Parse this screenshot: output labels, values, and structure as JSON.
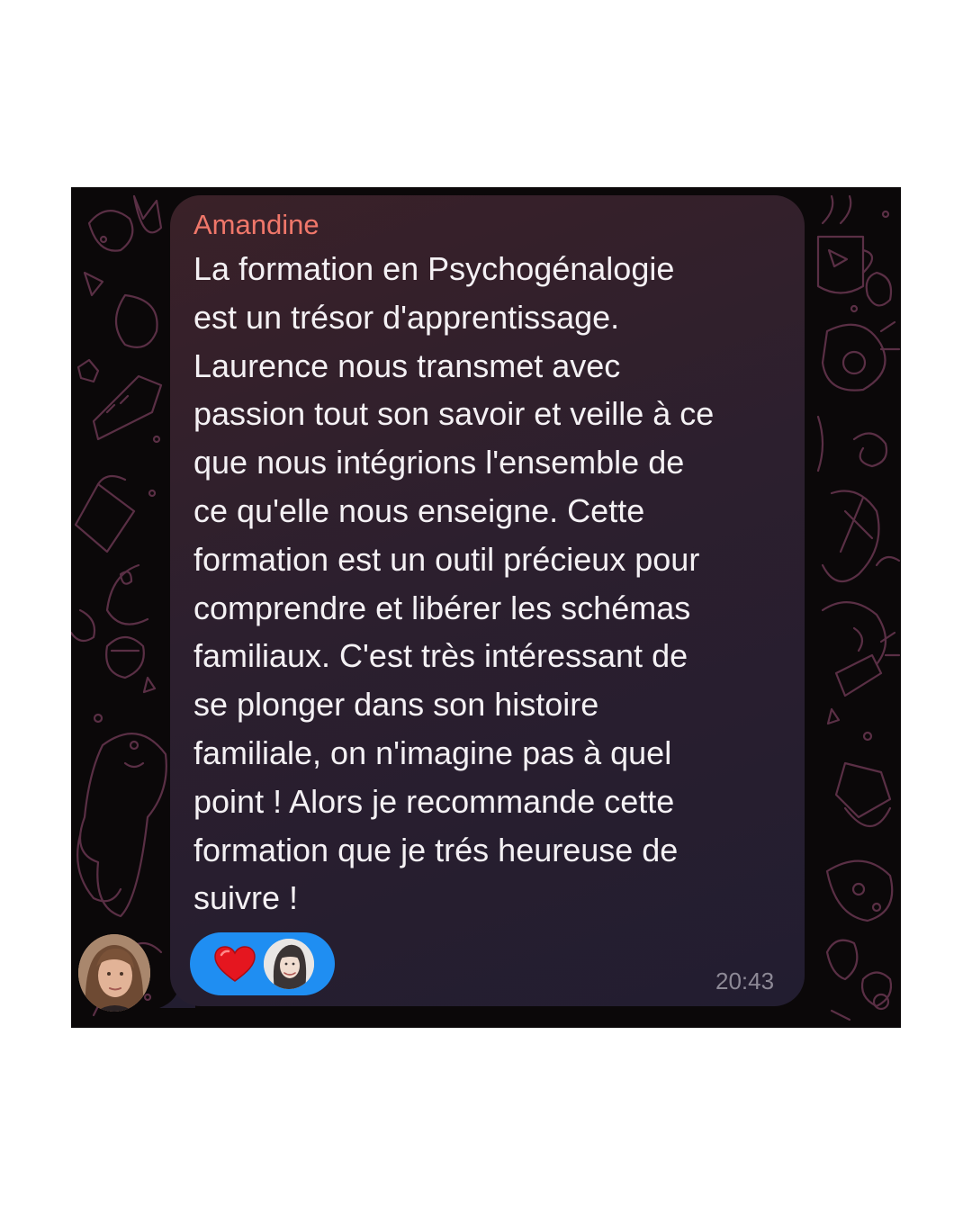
{
  "message": {
    "sender": "Amandine",
    "lines": [
      "La formation en Psychogénalogie",
      "est un trésor d'apprentissage.",
      "Laurence nous transmet avec",
      "passion tout son savoir et veille à ce",
      "que nous intégrions l'ensemble de",
      "ce qu'elle nous enseigne. Cette",
      "formation est un outil précieux pour",
      "comprendre et libérer les schémas",
      "familiaux. C'est très intéressant de",
      "se plonger dans son histoire",
      "familiale, on n'imagine pas à quel",
      "point ! Alors je recommande cette",
      "formation que je trés heureuse de",
      "suivre !"
    ],
    "time": "20:43",
    "reaction": {
      "emoji_icon": "red-heart-icon",
      "reactor": "reactor-avatar"
    }
  },
  "colors": {
    "sender_name": "#f0776a",
    "message_text": "#f4f1f4",
    "reaction_pill": "#1f8ef2",
    "timestamp": "#8d8996",
    "wallpaper_doodles": "#5a2f45"
  }
}
